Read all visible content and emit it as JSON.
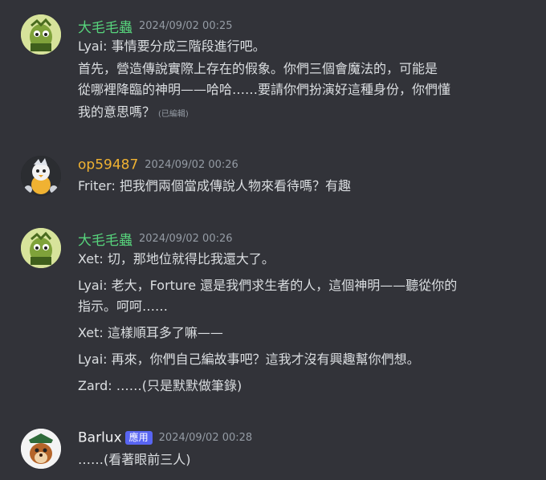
{
  "colors": {
    "background": "#323339",
    "author_green": "#57d37c",
    "author_yellow": "#f0b232",
    "author_white": "#f2f3f5",
    "timestamp": "#949ba4",
    "badge": "#5865f2"
  },
  "messages": [
    {
      "author": "大毛毛蟲",
      "timestamp": "2024/09/02 00:25",
      "lines": [
        "Lyai: 事情要分成三階段進行吧。",
        "首先，營造傳說實際上存在的假象。你們三個會魔法的，可能是",
        "從哪裡降臨的神明——哈哈……要請你們扮演好這種身份，你們懂",
        "我的意思嗎？"
      ],
      "edited": "(已編輯)"
    },
    {
      "author": "op59487",
      "timestamp": "2024/09/02 00:26",
      "lines": [
        "Friter: 把我們兩個當成傳說人物來看待嗎？有趣"
      ]
    },
    {
      "author": "大毛毛蟲",
      "timestamp": "2024/09/02 00:26",
      "lines": [
        "Xet: 切，那地位就得比我還大了。",
        "Lyai: 老大，Forture 還是我們求生者的人，這個神明——聽從你的",
        "指示。呵呵……",
        "Xet: 這樣順耳多了嘛——",
        "Lyai: 再來，你們自己編故事吧？這我才沒有興趣幫你們想。",
        "Zard: ……(只是默默做筆錄)"
      ]
    },
    {
      "author": "Barlux",
      "badge": "應用",
      "timestamp": "2024/09/02 00:28",
      "lines": [
        "……(看著眼前三人)"
      ]
    }
  ]
}
